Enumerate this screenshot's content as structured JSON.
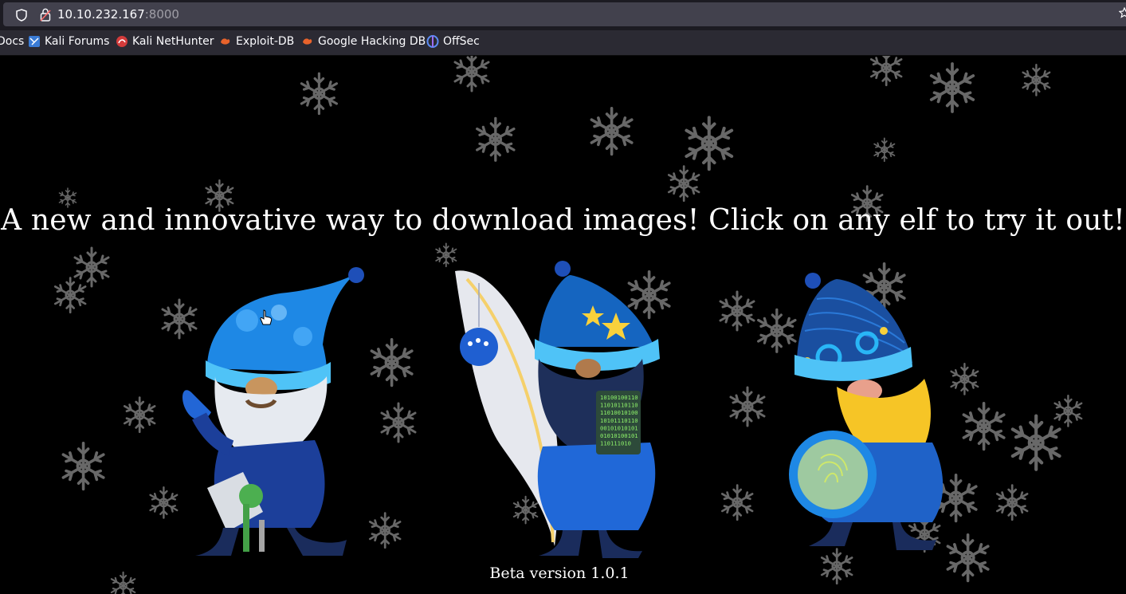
{
  "browser": {
    "url_host": "10.10.232.167",
    "url_port": ":8000",
    "bookmarks": [
      {
        "label": "Docs",
        "icon": "kali-docs-icon"
      },
      {
        "label": "Kali Forums",
        "icon": "kali-forums-icon"
      },
      {
        "label": "Kali NetHunter",
        "icon": "kali-nethunter-icon"
      },
      {
        "label": "Exploit-DB",
        "icon": "exploit-db-icon"
      },
      {
        "label": "Google Hacking DB",
        "icon": "ghdb-icon"
      },
      {
        "label": "OffSec",
        "icon": "offsec-icon"
      }
    ]
  },
  "page": {
    "headline": "A new and innovative way to download images! Click on any elf to try it out!",
    "elves": [
      {
        "name": "elf with keys",
        "hat_color": "#1e88e5"
      },
      {
        "name": "elf with quill and binary tablet",
        "hat_color": "#1565c0"
      },
      {
        "name": "elf with fingerprint magnifier",
        "hat_color": "#1a4fa0"
      }
    ],
    "tablet_binary": [
      "10100100110",
      "11010110110",
      "11010010100",
      "10101110110",
      "00101010101",
      "01010100101",
      "110111010"
    ],
    "version": "Beta version 1.0.1"
  },
  "colors": {
    "background": "#000000",
    "snowflake": "#bdbdbd",
    "chrome_bar": "#1c1b22",
    "bookmarks_bar": "#2b2a33"
  }
}
